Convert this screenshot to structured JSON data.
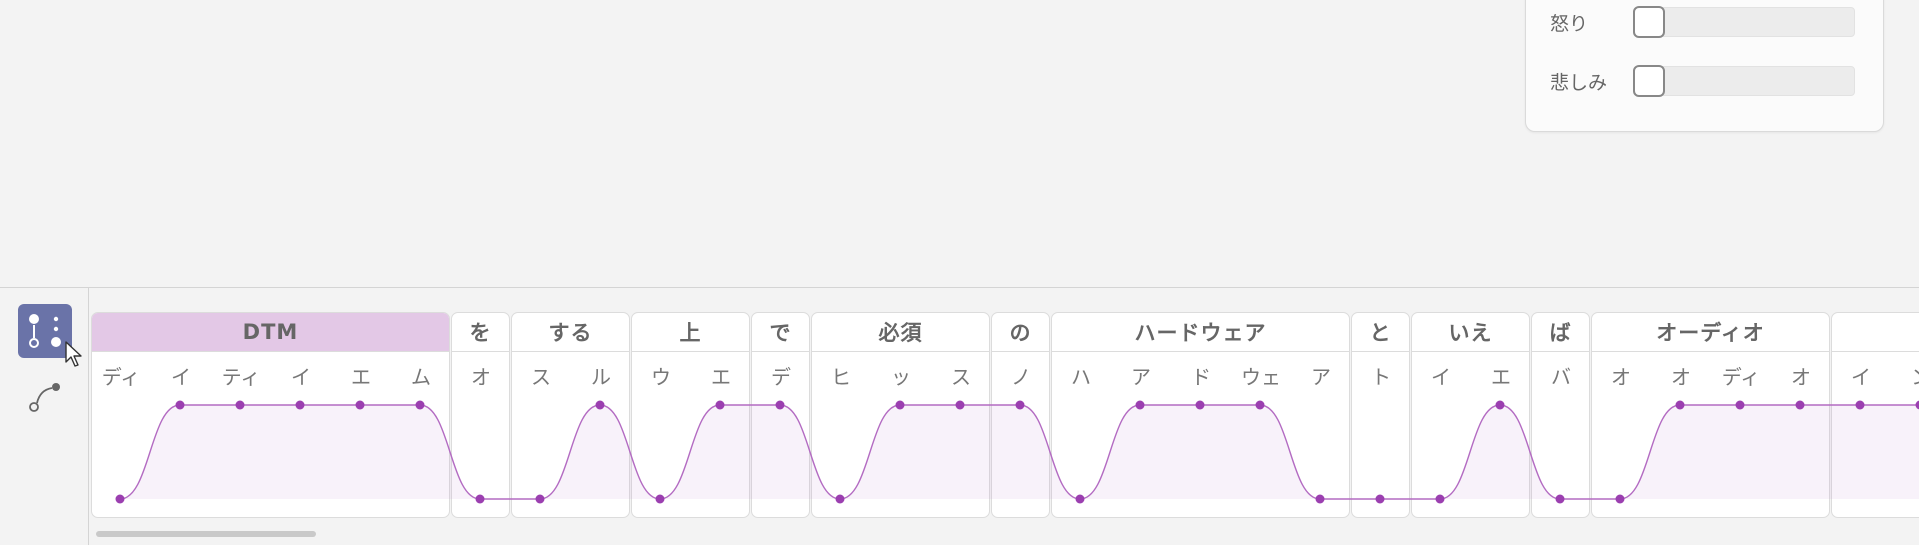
{
  "emotion_panel": {
    "sliders": [
      {
        "label": "怒り",
        "value": 0
      },
      {
        "label": "悲しみ",
        "value": 0
      }
    ]
  },
  "tools": [
    {
      "name": "select-tool",
      "icon": "node-select-icon",
      "active": true
    },
    {
      "name": "curve-tool",
      "icon": "curve-draw-icon",
      "active": false
    }
  ],
  "colors": {
    "selected_accent": "#e3c8e6",
    "pitch_line": "#b36bc2",
    "pitch_point": "#9b3fb0",
    "tool_active": "#6a73a8"
  },
  "accent_phrases": [
    {
      "text": "DTM",
      "selected": true,
      "moras": [
        {
          "kana": "ディ",
          "high": false
        },
        {
          "kana": "イ",
          "high": true
        },
        {
          "kana": "ティ",
          "high": true
        },
        {
          "kana": "イ",
          "high": true
        },
        {
          "kana": "エ",
          "high": true
        },
        {
          "kana": "ム",
          "high": true
        }
      ]
    },
    {
      "text": "を",
      "moras": [
        {
          "kana": "オ",
          "high": false
        }
      ]
    },
    {
      "text": "する",
      "moras": [
        {
          "kana": "ス",
          "high": false
        },
        {
          "kana": "ル",
          "high": true
        }
      ]
    },
    {
      "text": "上",
      "moras": [
        {
          "kana": "ウ",
          "high": false
        },
        {
          "kana": "エ",
          "high": true
        }
      ]
    },
    {
      "text": "で",
      "moras": [
        {
          "kana": "デ",
          "high": true
        }
      ]
    },
    {
      "text": "必須",
      "moras": [
        {
          "kana": "ヒ",
          "high": false
        },
        {
          "kana": "ッ",
          "high": true
        },
        {
          "kana": "ス",
          "high": true
        }
      ]
    },
    {
      "text": "の",
      "moras": [
        {
          "kana": "ノ",
          "high": true
        }
      ]
    },
    {
      "text": "ハードウェア",
      "moras": [
        {
          "kana": "ハ",
          "high": false
        },
        {
          "kana": "ア",
          "high": true
        },
        {
          "kana": "ド",
          "high": true
        },
        {
          "kana": "ウェ",
          "high": true
        },
        {
          "kana": "ア",
          "high": false
        }
      ]
    },
    {
      "text": "と",
      "moras": [
        {
          "kana": "ト",
          "high": false
        }
      ]
    },
    {
      "text": "いえ",
      "moras": [
        {
          "kana": "イ",
          "high": false
        },
        {
          "kana": "エ",
          "high": true
        }
      ]
    },
    {
      "text": "ば",
      "moras": [
        {
          "kana": "バ",
          "high": false
        }
      ]
    },
    {
      "text": "オーディオ",
      "moras": [
        {
          "kana": "オ",
          "high": false
        },
        {
          "kana": "オ",
          "high": true
        },
        {
          "kana": "ディ",
          "high": true
        },
        {
          "kana": "オ",
          "high": true
        }
      ]
    },
    {
      "text": "",
      "moras": [
        {
          "kana": "イ",
          "high": true
        },
        {
          "kana": "ン",
          "high": true
        }
      ]
    }
  ]
}
